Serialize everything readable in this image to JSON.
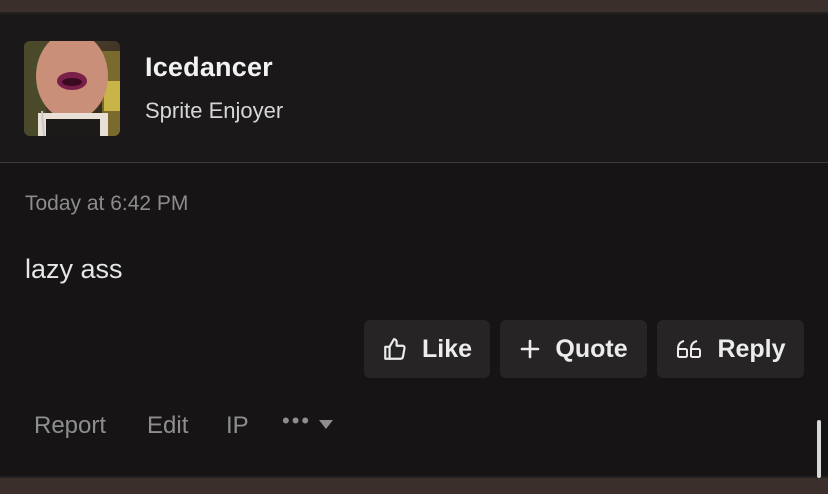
{
  "post": {
    "username": "Icedancer",
    "user_title": "Sprite Enjoyer",
    "timestamp": "Today at 6:42 PM",
    "message": "lazy ass",
    "avatar_icon": "user-avatar-photo"
  },
  "actions": {
    "like_label": "Like",
    "quote_label": "Quote",
    "reply_label": "Reply",
    "like_icon": "thumbs-up-icon",
    "quote_icon": "plus-icon",
    "reply_icon": "quote-marks-icon"
  },
  "footer": {
    "report_label": "Report",
    "edit_label": "Edit",
    "ip_label": "IP",
    "more_icon": "more-dots-icon"
  },
  "colors": {
    "background": "#161415",
    "header_background": "#1a1819",
    "button_background": "#262425",
    "frame": "#3b2f2c"
  }
}
